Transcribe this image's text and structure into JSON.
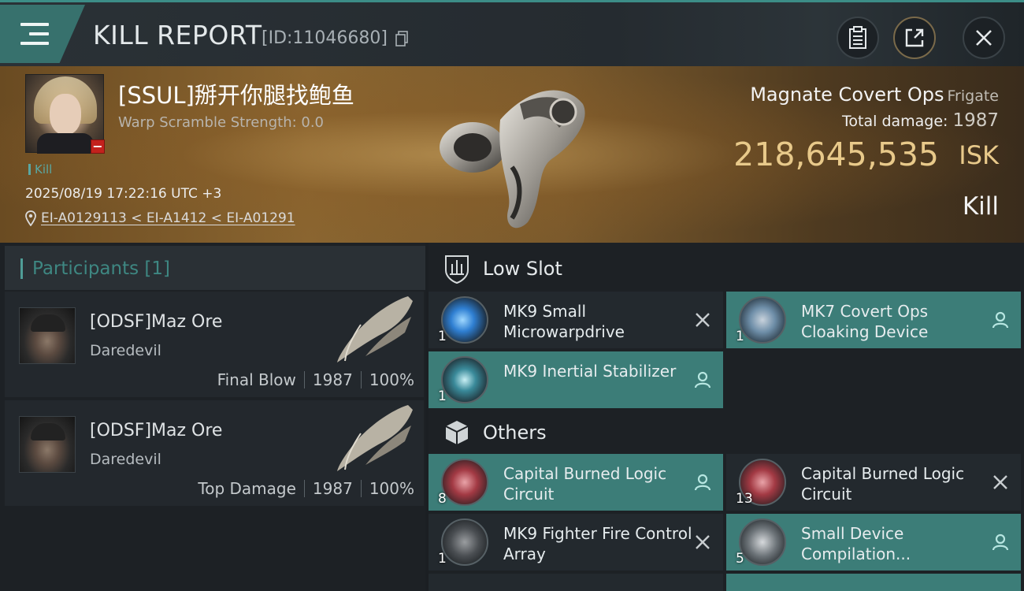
{
  "header": {
    "title": "KILL REPORT",
    "report_id": "[ID:11046680]"
  },
  "victim": {
    "name": "[SSUL]掰开你腿找鲍鱼",
    "warp_scramble": "Warp Scramble Strength: 0.0",
    "kill_tag": "Kill",
    "timestamp": "2025/08/19 17:22:16 UTC +3",
    "location": "EI-A0129113 < EI-A1412 < EI-A01291",
    "ship_name": "Magnate Covert Ops",
    "ship_class": "Frigate",
    "total_damage_label": "Total damage:",
    "total_damage": "1987",
    "isk_value": "218,645,535",
    "isk_unit": "ISK",
    "result": "Kill"
  },
  "participants": {
    "header": "Participants [1]",
    "list": [
      {
        "name": "[ODSF]Maz Ore",
        "ship": "Daredevil",
        "role": "Final Blow",
        "damage": "1987",
        "percent": "100%"
      },
      {
        "name": "[ODSF]Maz Ore",
        "ship": "Daredevil",
        "role": "Top Damage",
        "damage": "1987",
        "percent": "100%"
      }
    ]
  },
  "sections": {
    "low_slot": "Low Slot",
    "others": "Others"
  },
  "items": {
    "low_slot": [
      {
        "name": "MK9 Small Microwarpdrive",
        "qty": "1",
        "state": "destroyed",
        "action_icon": "close-icon"
      },
      {
        "name": "MK7 Covert Ops Cloaking Device",
        "qty": "1",
        "state": "dropped",
        "action_icon": "person-icon"
      },
      {
        "name": "MK9 Inertial Stabilizer",
        "qty": "1",
        "state": "dropped",
        "action_icon": "person-icon"
      }
    ],
    "others": [
      {
        "name": "Capital Burned Logic Circuit",
        "qty": "8",
        "state": "dropped",
        "action_icon": "person-icon"
      },
      {
        "name": "Capital Burned Logic Circuit",
        "qty": "13",
        "state": "destroyed",
        "action_icon": "close-icon"
      },
      {
        "name": "MK9 Fighter Fire Control Array",
        "qty": "1",
        "state": "destroyed",
        "action_icon": "close-icon"
      },
      {
        "name": "Small Device Compilation...",
        "qty": "5",
        "state": "dropped",
        "action_icon": "person-icon"
      }
    ]
  },
  "colors": {
    "accent_teal": "#3c7d78",
    "isk_gold": "#e8c98a",
    "panel_dark": "#23292e"
  }
}
